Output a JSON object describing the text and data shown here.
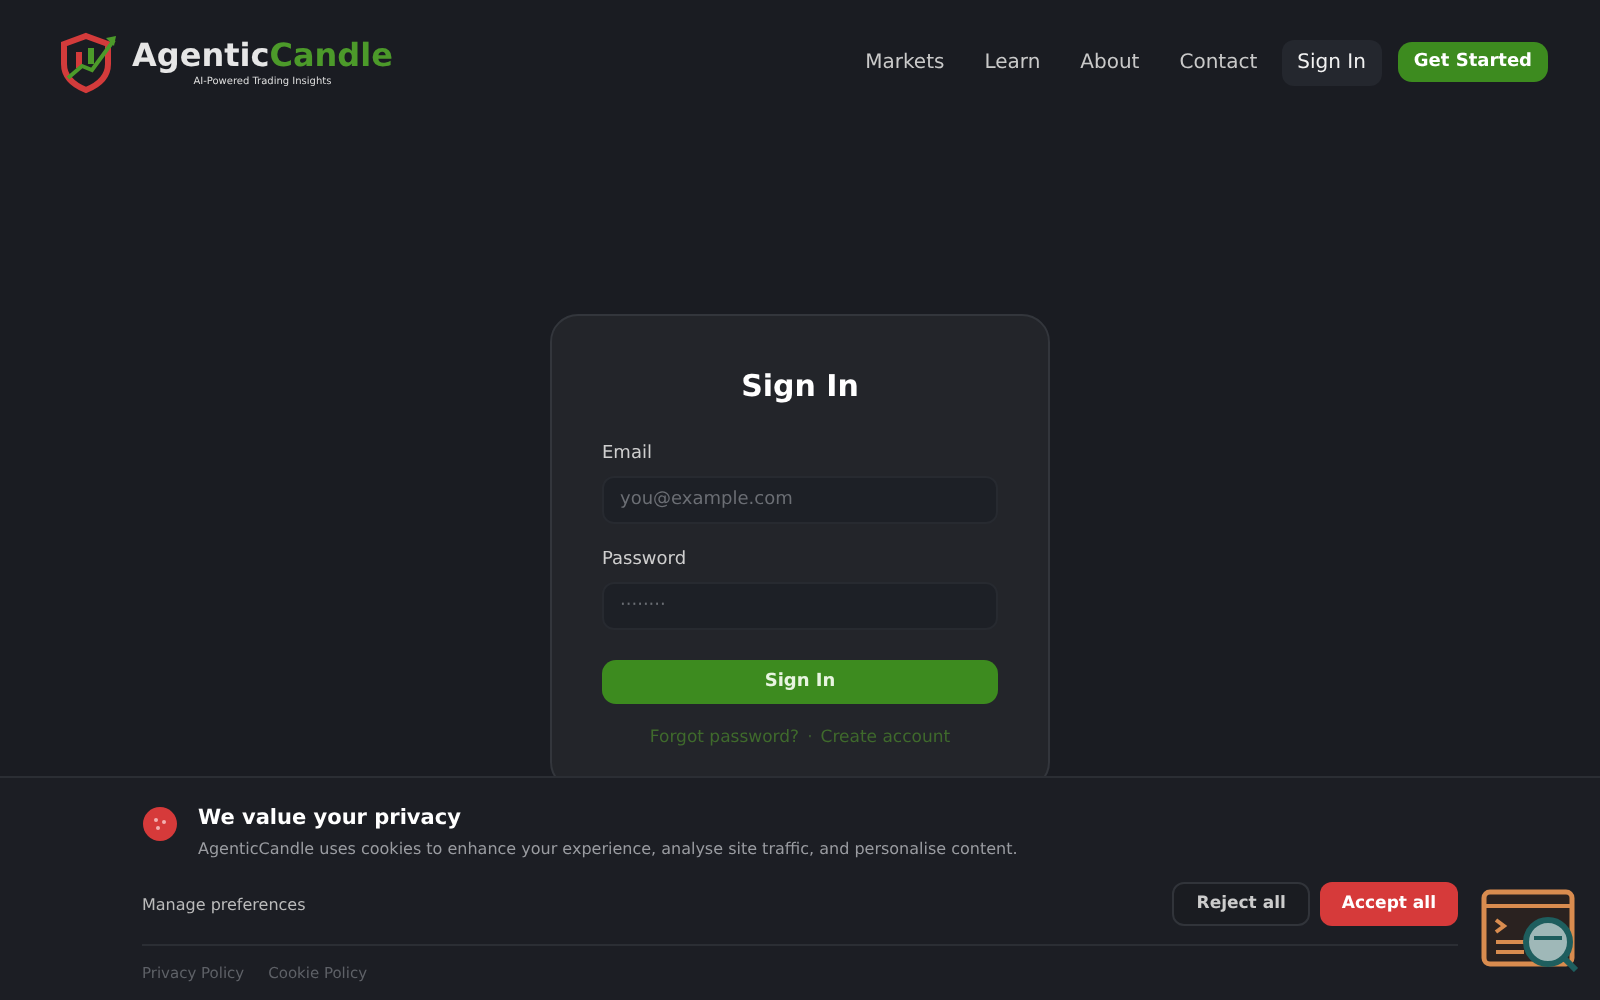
{
  "header": {
    "logo": {
      "name_first": "Agentic",
      "name_second": "Candle",
      "tagline": "AI-Powered Trading Insights"
    },
    "nav": [
      {
        "label": "Markets",
        "selected": false
      },
      {
        "label": "Learn",
        "selected": false
      },
      {
        "label": "About",
        "selected": false
      },
      {
        "label": "Contact",
        "selected": false
      },
      {
        "label": "Sign In",
        "selected": true
      }
    ],
    "cta": "Get Started"
  },
  "signin_card": {
    "title": "Sign In",
    "fields": [
      {
        "label": "Email",
        "placeholder": "you@example.com"
      },
      {
        "label": "Password",
        "placeholder": "········"
      }
    ],
    "submit": "Sign In",
    "links": [
      "Forgot password?",
      "Create account"
    ],
    "separator": "·"
  },
  "cookie_banner": {
    "title": "We value your privacy",
    "message": "AgenticCandle uses cookies to enhance your experience, analyse site traffic, and personalise content.",
    "manage": "Manage preferences",
    "reject": "Reject all",
    "accept": "Accept all",
    "footer_links": [
      "Privacy Policy",
      "Cookie Policy"
    ]
  }
}
